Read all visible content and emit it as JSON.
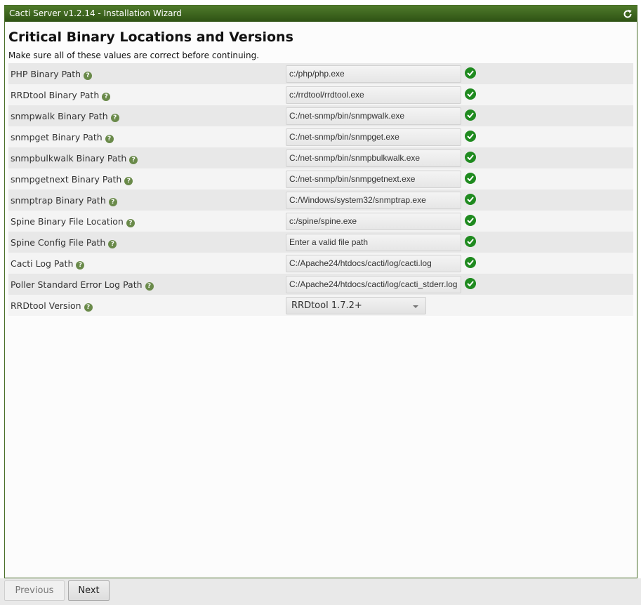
{
  "window": {
    "title": "Cacti Server v1.2.14 - Installation Wizard",
    "refresh_icon": "refresh-icon"
  },
  "page": {
    "heading": "Critical Binary Locations and Versions",
    "description": "Make sure all of these values are correct before continuing."
  },
  "rows": [
    {
      "label": "PHP Binary Path",
      "value": "c:/php/php.exe",
      "valid": true
    },
    {
      "label": "RRDtool Binary Path",
      "value": "c:/rrdtool/rrdtool.exe",
      "valid": true
    },
    {
      "label": "snmpwalk Binary Path",
      "value": "C:/net-snmp/bin/snmpwalk.exe",
      "valid": true
    },
    {
      "label": "snmpget Binary Path",
      "value": "C:/net-snmp/bin/snmpget.exe",
      "valid": true
    },
    {
      "label": "snmpbulkwalk Binary Path",
      "value": "C:/net-snmp/bin/snmpbulkwalk.exe",
      "valid": true
    },
    {
      "label": "snmpgetnext Binary Path",
      "value": "C:/net-snmp/bin/snmpgetnext.exe",
      "valid": true
    },
    {
      "label": "snmptrap Binary Path",
      "value": "C:/Windows/system32/snmptrap.exe",
      "valid": true
    },
    {
      "label": "Spine Binary File Location",
      "value": "c:/spine/spine.exe",
      "valid": true
    },
    {
      "label": "Spine Config File Path",
      "value": "Enter a valid file path",
      "valid": true
    },
    {
      "label": "Cacti Log Path",
      "value": "C:/Apache24/htdocs/cacti/log/cacti.log",
      "valid": true
    },
    {
      "label": "Poller Standard Error Log Path",
      "value": "C:/Apache24/htdocs/cacti/log/cacti_stderr.log",
      "valid": true
    }
  ],
  "rrdtool_version": {
    "label": "RRDtool Version",
    "selected": "RRDtool 1.7.2+"
  },
  "help_glyph": "?",
  "buttons": {
    "previous": "Previous",
    "next": "Next"
  },
  "colors": {
    "titlebar": "#3d6620",
    "valid_check": "#1f8a1f",
    "help_icon": "#6a8a4a"
  }
}
